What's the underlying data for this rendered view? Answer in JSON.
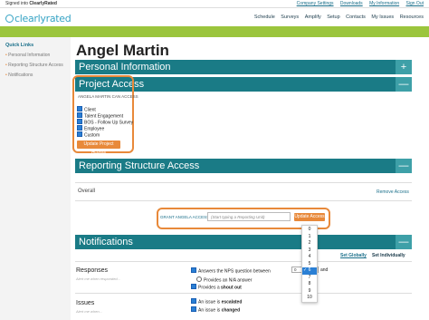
{
  "topbar": {
    "signed_in_prefix": "Signed into ",
    "signed_in_account": "ClearlyRated",
    "links": [
      "Company Settings",
      "Downloads",
      "My Information",
      "Sign Out"
    ]
  },
  "header": {
    "logo_text": "clearlyrated",
    "nav": [
      "Schedule",
      "Surveys",
      "Amplify",
      "Setup",
      "Contacts",
      "My Issues",
      "Resources"
    ]
  },
  "sidebar": {
    "title": "Quick Links",
    "items": [
      "Personal Information",
      "Reporting Structure Access",
      "Notifications"
    ]
  },
  "page": {
    "title": "Angel Martin"
  },
  "sections": {
    "personal_info": {
      "title": "Personal Information",
      "btn": "+"
    },
    "project_access": {
      "title": "Project Access",
      "btn": "—",
      "label": "ANGELA MARTIN CAN ACCESS",
      "checkboxes": [
        "Client",
        "Talent Engagement",
        "BOS - Follow Up Survey",
        "Employee",
        "Custom"
      ],
      "update_btn": "Update Project Access"
    },
    "reporting": {
      "title": "Reporting Structure Access",
      "btn": "—",
      "overall": "Overall",
      "remove": "Remove Access",
      "grant_label": "GRANT ANGELA ACCESS TO",
      "grant_placeholder": "(Start typing a Reporting Unit)",
      "update_btn": "Update Access"
    },
    "notifications": {
      "title": "Notifications",
      "btn": "—",
      "tab_global": "Set Globally",
      "tab_individual": "Set Individually",
      "responses": {
        "title": "Responses",
        "desc": "Alert me when responded...",
        "opt1_prefix": "Answers the NPS question between",
        "opt1_select": "0",
        "opt1_suffix": "and",
        "opt2": "Provides an N/A answer",
        "opt3_prefix": "Provides a ",
        "opt3_bold": "shout out"
      },
      "issues": {
        "title": "Issues",
        "desc": "Alert me when...",
        "opt1_prefix": "An issue is ",
        "opt1_bold": "escalated",
        "opt2_prefix": "An issue is ",
        "opt2_bold": "changed"
      }
    }
  },
  "dropdown": {
    "options": [
      "0",
      "1",
      "2",
      "3",
      "4",
      "5",
      "6",
      "7",
      "8",
      "9",
      "10"
    ],
    "selected": "6"
  },
  "colors": {
    "teal_bar": "#1a7b86",
    "green_band": "#9bc53d",
    "orange_accent": "#e8893a",
    "link_blue": "#1a6f8a"
  }
}
